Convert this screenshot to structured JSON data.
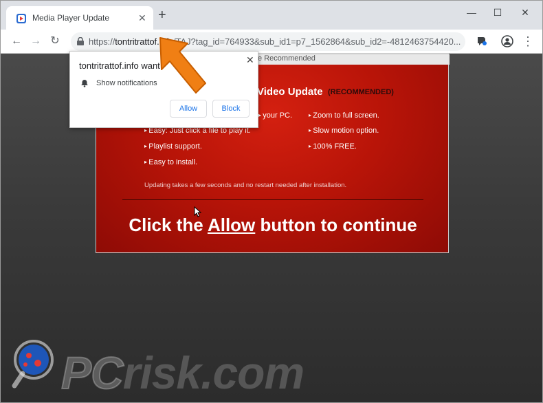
{
  "browser": {
    "tab_title": "Media Player Update",
    "tab_close": "✕",
    "new_tab": "+",
    "window": {
      "minimize": "—",
      "maximize": "☐",
      "close": "✕"
    },
    "nav": {
      "back": "←",
      "forward": "→",
      "reload": "↻"
    },
    "url": {
      "scheme": "https://",
      "host": "tontritrattof.info",
      "rest": "/TAJ?tag_id=764933&sub_id1=p7_1562864&sub_id2=-4812463754420..."
    },
    "star": "☆",
    "menu": "⋮"
  },
  "popup": {
    "text": "tontritrattof.info want",
    "close": "✕",
    "notification_label": "Show notifications",
    "allow_label": "Allow",
    "block_label": "Block"
  },
  "page": {
    "card_top_text": "te Recommended",
    "heading": "Video Update",
    "heading_tag": "(RECOMMENDED)",
    "features_left": [
      "your PC.",
      "Easy: Just click a file to play it.",
      "Playlist support.",
      "Easy to install."
    ],
    "features_right": [
      "Zoom to full screen.",
      "Slow motion option.",
      "100% FREE."
    ],
    "note": "Updating takes a few seconds and no restart needed after installation.",
    "cta_before": "Click the ",
    "cta_allow": "Allow",
    "cta_after": " button to continue"
  },
  "watermark": {
    "pc": "PC",
    "rest": "risk.com"
  },
  "icons": {
    "favicon": "media-player-icon",
    "lock": "lock-icon",
    "bell": "bell-icon",
    "arrow": "orange-arrow-icon",
    "watermark_logo": "magnifier-logo"
  },
  "colors": {
    "card_red": "#b81408",
    "arrow_orange": "#f07f14",
    "link_blue": "#1a73e8"
  }
}
